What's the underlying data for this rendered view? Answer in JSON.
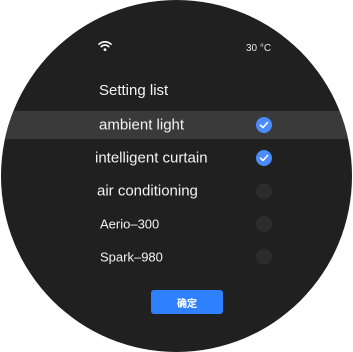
{
  "status": {
    "wifi_icon": "wifi-icon",
    "temperature": "30 °C"
  },
  "title": "Setting list",
  "items": [
    {
      "label": "ambient light",
      "checked": true,
      "selected": true
    },
    {
      "label": "intelligent curtain",
      "checked": true,
      "selected": false
    },
    {
      "label": "air conditioning",
      "checked": false,
      "selected": false
    },
    {
      "label": "Aerio–300",
      "checked": false,
      "selected": false
    },
    {
      "label": "Spark–980",
      "checked": false,
      "selected": false
    }
  ],
  "confirm_label": "确定",
  "colors": {
    "background": "#202020",
    "accent": "#2f80ff",
    "check_on": "#4a8cff"
  }
}
